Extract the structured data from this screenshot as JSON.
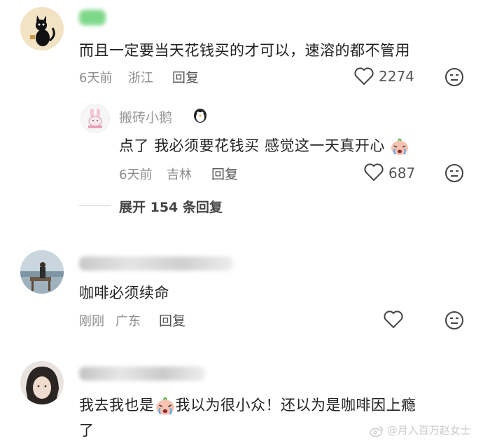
{
  "comments": [
    {
      "text": "而且一定要当天花钱买的才可以，速溶的都不管用",
      "time": "6天前",
      "location": "浙江",
      "reply_label": "回复",
      "likes": "2274",
      "replies": [
        {
          "username": "搬砖小鹅",
          "text": "点了 我必须要花钱买 感觉这一天真开心",
          "time": "6天前",
          "location": "吉林",
          "reply_label": "回复",
          "likes": "687"
        }
      ],
      "expand_label": "展开 154 条回复"
    },
    {
      "text": "咖啡必须续命",
      "time": "刚刚",
      "location": "广东",
      "reply_label": "回复"
    },
    {
      "text_part1": "我去我也是",
      "text_part2": "我以为很小众！还以为是咖啡因上瘾",
      "text_line2": "了"
    }
  ],
  "watermark": "@月入百万赵女士",
  "icons": {
    "like": "heart-outline-icon",
    "dislike": "neutral-face-icon",
    "crying_sticker": "crying-face-emoji-icon",
    "penguin": "penguin-emoji-icon",
    "weibo": "weibo-logo-icon"
  },
  "colors": {
    "text": "#222222",
    "meta": "#8c8c8c",
    "username": "#9a9a9a",
    "divider": "#d6d6d6",
    "blurred_name_green": "#7fd88a"
  }
}
